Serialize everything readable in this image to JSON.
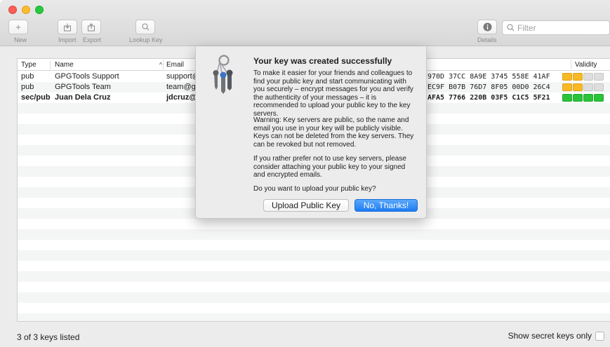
{
  "toolbar": {
    "new_label": "New",
    "import_label": "Import",
    "export_label": "Export",
    "lookup_label": "Lookup Key",
    "details_label": "Details",
    "filter_placeholder": "Filter"
  },
  "table": {
    "columns": {
      "type": "Type",
      "name": "Name",
      "email": "Email",
      "validity": "Validity"
    },
    "rows": [
      {
        "type": "pub",
        "name": "GPGTools Support",
        "email": "support@",
        "fingerprint": "970D  37CC 8A9E 3745 558E 41AF",
        "validity": "partial",
        "secret": false
      },
      {
        "type": "pub",
        "name": "GPGTools Team",
        "email": "team@gp",
        "fingerprint": "EC9F  B07B 76D7 8F05 00D0 26C4",
        "validity": "partial",
        "secret": false
      },
      {
        "type": "sec/pub",
        "name": "Juan Dela Cruz",
        "email": "jdcruz@",
        "fingerprint": "AFA5  7766 220B 03F5 C1C5 5F21",
        "validity": "full",
        "secret": true
      }
    ]
  },
  "status": {
    "count_text": "3 of 3 keys listed",
    "show_secret_label": "Show secret keys only"
  },
  "sheet": {
    "title": "Your key was created successfully",
    "p1": "To make it easier for your friends and colleagues to find your public key and start communicating with you securely – encrypt messages for you and verify the authenticity of your messages – it is recommended to upload your public key to the key servers.",
    "p2": "Warning: Key servers are public, so the name and email you use in your key will be publicly visible. Keys can not be deleted from the key servers. They can be revoked but not removed.",
    "p3": "If you rather prefer not to use key servers, please consider attaching your public key to your signed and encrypted emails.",
    "p4": "Do you want to upload your public key?",
    "upload_label": "Upload Public Key",
    "decline_label": "No, Thanks!",
    "icon": "keys-icon"
  },
  "colors": {
    "validity_partial": "#f7b924",
    "validity_full": "#2bc33a",
    "validity_empty": "#dedede",
    "accent": "#1c7cf3"
  }
}
